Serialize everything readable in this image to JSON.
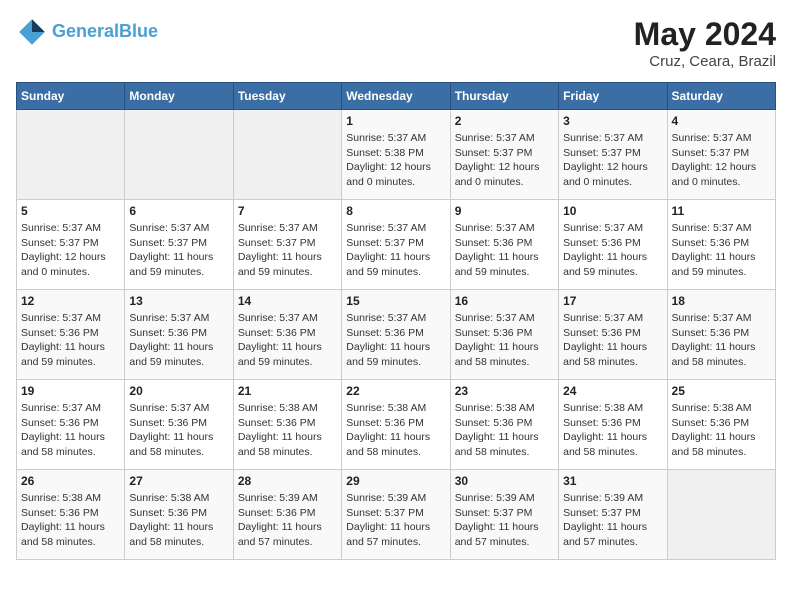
{
  "header": {
    "logo_line1": "General",
    "logo_line2": "Blue",
    "month_title": "May 2024",
    "subtitle": "Cruz, Ceara, Brazil"
  },
  "days_of_week": [
    "Sunday",
    "Monday",
    "Tuesday",
    "Wednesday",
    "Thursday",
    "Friday",
    "Saturday"
  ],
  "weeks": [
    [
      {
        "day": "",
        "empty": true
      },
      {
        "day": "",
        "empty": true
      },
      {
        "day": "",
        "empty": true
      },
      {
        "day": "1",
        "sunrise": "5:37 AM",
        "sunset": "5:38 PM",
        "daylight": "12 hours and 0 minutes."
      },
      {
        "day": "2",
        "sunrise": "5:37 AM",
        "sunset": "5:37 PM",
        "daylight": "12 hours and 0 minutes."
      },
      {
        "day": "3",
        "sunrise": "5:37 AM",
        "sunset": "5:37 PM",
        "daylight": "12 hours and 0 minutes."
      },
      {
        "day": "4",
        "sunrise": "5:37 AM",
        "sunset": "5:37 PM",
        "daylight": "12 hours and 0 minutes."
      }
    ],
    [
      {
        "day": "5",
        "sunrise": "5:37 AM",
        "sunset": "5:37 PM",
        "daylight": "12 hours and 0 minutes."
      },
      {
        "day": "6",
        "sunrise": "5:37 AM",
        "sunset": "5:37 PM",
        "daylight": "11 hours and 59 minutes."
      },
      {
        "day": "7",
        "sunrise": "5:37 AM",
        "sunset": "5:37 PM",
        "daylight": "11 hours and 59 minutes."
      },
      {
        "day": "8",
        "sunrise": "5:37 AM",
        "sunset": "5:37 PM",
        "daylight": "11 hours and 59 minutes."
      },
      {
        "day": "9",
        "sunrise": "5:37 AM",
        "sunset": "5:36 PM",
        "daylight": "11 hours and 59 minutes."
      },
      {
        "day": "10",
        "sunrise": "5:37 AM",
        "sunset": "5:36 PM",
        "daylight": "11 hours and 59 minutes."
      },
      {
        "day": "11",
        "sunrise": "5:37 AM",
        "sunset": "5:36 PM",
        "daylight": "11 hours and 59 minutes."
      }
    ],
    [
      {
        "day": "12",
        "sunrise": "5:37 AM",
        "sunset": "5:36 PM",
        "daylight": "11 hours and 59 minutes."
      },
      {
        "day": "13",
        "sunrise": "5:37 AM",
        "sunset": "5:36 PM",
        "daylight": "11 hours and 59 minutes."
      },
      {
        "day": "14",
        "sunrise": "5:37 AM",
        "sunset": "5:36 PM",
        "daylight": "11 hours and 59 minutes."
      },
      {
        "day": "15",
        "sunrise": "5:37 AM",
        "sunset": "5:36 PM",
        "daylight": "11 hours and 59 minutes."
      },
      {
        "day": "16",
        "sunrise": "5:37 AM",
        "sunset": "5:36 PM",
        "daylight": "11 hours and 58 minutes."
      },
      {
        "day": "17",
        "sunrise": "5:37 AM",
        "sunset": "5:36 PM",
        "daylight": "11 hours and 58 minutes."
      },
      {
        "day": "18",
        "sunrise": "5:37 AM",
        "sunset": "5:36 PM",
        "daylight": "11 hours and 58 minutes."
      }
    ],
    [
      {
        "day": "19",
        "sunrise": "5:37 AM",
        "sunset": "5:36 PM",
        "daylight": "11 hours and 58 minutes."
      },
      {
        "day": "20",
        "sunrise": "5:37 AM",
        "sunset": "5:36 PM",
        "daylight": "11 hours and 58 minutes."
      },
      {
        "day": "21",
        "sunrise": "5:38 AM",
        "sunset": "5:36 PM",
        "daylight": "11 hours and 58 minutes."
      },
      {
        "day": "22",
        "sunrise": "5:38 AM",
        "sunset": "5:36 PM",
        "daylight": "11 hours and 58 minutes."
      },
      {
        "day": "23",
        "sunrise": "5:38 AM",
        "sunset": "5:36 PM",
        "daylight": "11 hours and 58 minutes."
      },
      {
        "day": "24",
        "sunrise": "5:38 AM",
        "sunset": "5:36 PM",
        "daylight": "11 hours and 58 minutes."
      },
      {
        "day": "25",
        "sunrise": "5:38 AM",
        "sunset": "5:36 PM",
        "daylight": "11 hours and 58 minutes."
      }
    ],
    [
      {
        "day": "26",
        "sunrise": "5:38 AM",
        "sunset": "5:36 PM",
        "daylight": "11 hours and 58 minutes."
      },
      {
        "day": "27",
        "sunrise": "5:38 AM",
        "sunset": "5:36 PM",
        "daylight": "11 hours and 58 minutes."
      },
      {
        "day": "28",
        "sunrise": "5:39 AM",
        "sunset": "5:36 PM",
        "daylight": "11 hours and 57 minutes."
      },
      {
        "day": "29",
        "sunrise": "5:39 AM",
        "sunset": "5:37 PM",
        "daylight": "11 hours and 57 minutes."
      },
      {
        "day": "30",
        "sunrise": "5:39 AM",
        "sunset": "5:37 PM",
        "daylight": "11 hours and 57 minutes."
      },
      {
        "day": "31",
        "sunrise": "5:39 AM",
        "sunset": "5:37 PM",
        "daylight": "11 hours and 57 minutes."
      },
      {
        "day": "",
        "empty": true
      }
    ]
  ],
  "labels": {
    "sunrise": "Sunrise:",
    "sunset": "Sunset:",
    "daylight": "Daylight:"
  }
}
